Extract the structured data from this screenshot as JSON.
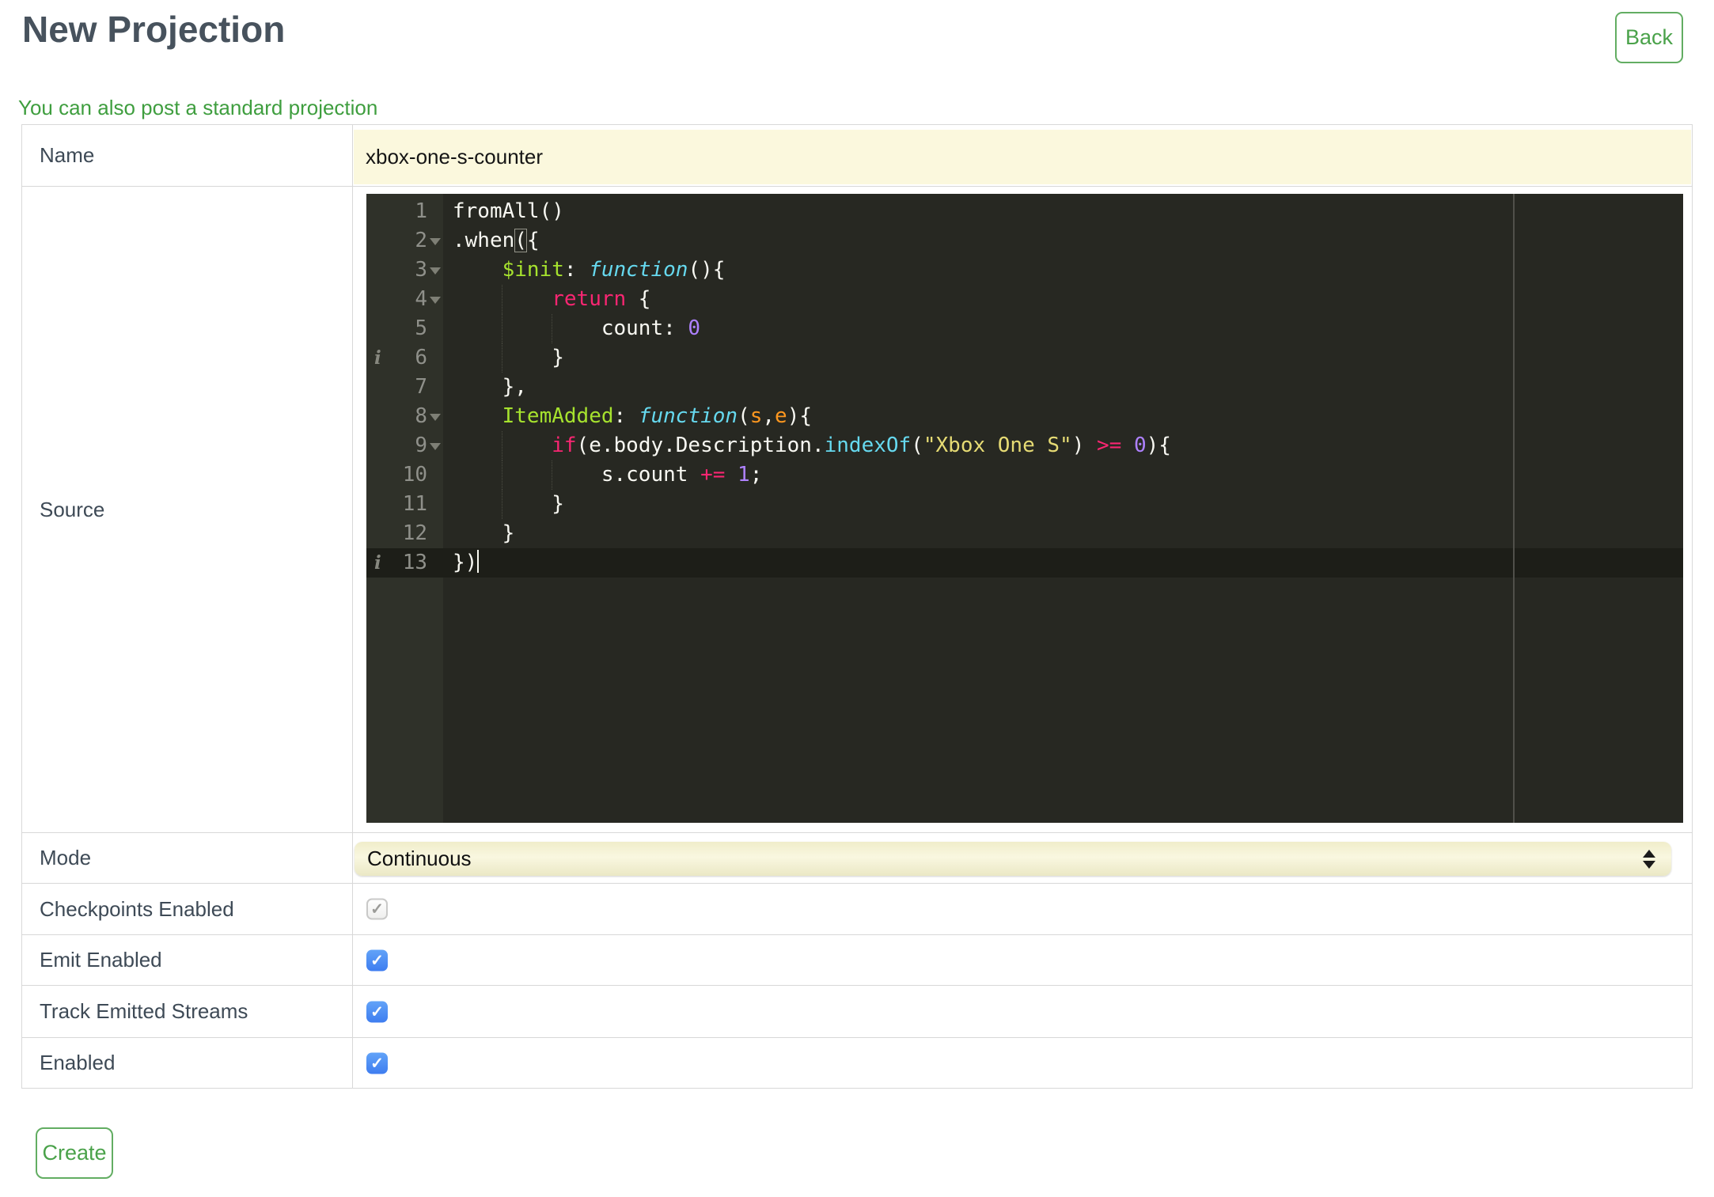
{
  "colors": {
    "accent_green": "#4aa24a",
    "link_green": "#3f9e3f",
    "checkbox_blue": "#4285f4",
    "field_yellow": "#fbf8dd",
    "select_yellow": "#f5f2d6",
    "editor_background": "#272822",
    "editor_gutter": "#2f3129",
    "label_text": "#3e4a56"
  },
  "icons": {
    "check": "✓",
    "info": "i"
  },
  "header": {
    "title": "New Projection",
    "back_label": "Back"
  },
  "standard_projection_link": "You can also post a standard projection",
  "form": {
    "name": {
      "label": "Name",
      "value": "xbox-one-s-counter"
    },
    "source": {
      "label": "Source"
    },
    "mode": {
      "label": "Mode",
      "value": "Continuous"
    },
    "checkpoints": {
      "label": "Checkpoints Enabled",
      "checked": true,
      "disabled": true
    },
    "emit": {
      "label": "Emit Enabled",
      "checked": true,
      "disabled": false
    },
    "track": {
      "label": "Track Emitted Streams",
      "checked": true,
      "disabled": false
    },
    "enabled": {
      "label": "Enabled",
      "checked": true,
      "disabled": false
    },
    "create_label": "Create"
  },
  "source_editor": {
    "value": "fromAll()\n.when({\n    $init: function(){\n        return {\n            count: 0\n        }\n    },\n    ItemAdded: function(s,e){\n        if(e.body.Description.indexOf(\"Xbox One S\") >= 0){\n            s.count += 1;\n        }\n    }\n})",
    "active_line": 13,
    "lines": [
      {
        "number": 1,
        "tokens": [
          [
            "fromAll()",
            "text"
          ]
        ]
      },
      {
        "number": 2,
        "fold": true,
        "tokens": [
          [
            ".when",
            "text"
          ],
          [
            "(",
            "text bracket"
          ],
          [
            "{",
            "text"
          ]
        ]
      },
      {
        "number": 3,
        "fold": true,
        "tokens": [
          [
            "    ",
            "text"
          ],
          [
            "$init",
            "entity"
          ],
          [
            ": ",
            "text"
          ],
          [
            "function",
            "fn"
          ],
          [
            "(){",
            "text"
          ]
        ]
      },
      {
        "number": 4,
        "fold": true,
        "guides": [
          4
        ],
        "tokens": [
          [
            "        ",
            "text"
          ],
          [
            "return",
            "kw"
          ],
          [
            " {",
            "text"
          ]
        ]
      },
      {
        "number": 5,
        "guides": [
          4,
          8
        ],
        "tokens": [
          [
            "            count: ",
            "text"
          ],
          [
            "0",
            "num"
          ]
        ]
      },
      {
        "number": 6,
        "info": true,
        "guides": [
          4
        ],
        "tokens": [
          [
            "        }",
            "text"
          ]
        ]
      },
      {
        "number": 7,
        "tokens": [
          [
            "    },",
            "text"
          ]
        ]
      },
      {
        "number": 8,
        "fold": true,
        "tokens": [
          [
            "    ",
            "text"
          ],
          [
            "ItemAdded",
            "entity"
          ],
          [
            ": ",
            "text"
          ],
          [
            "function",
            "fn"
          ],
          [
            "(",
            "text"
          ],
          [
            "s",
            "param"
          ],
          [
            ",",
            "text"
          ],
          [
            "e",
            "param"
          ],
          [
            "){",
            "text"
          ]
        ]
      },
      {
        "number": 9,
        "fold": true,
        "guides": [
          4
        ],
        "tokens": [
          [
            "        ",
            "text"
          ],
          [
            "if",
            "kw"
          ],
          [
            "(e.body.Description.",
            "text"
          ],
          [
            "indexOf",
            "support"
          ],
          [
            "(",
            "text"
          ],
          [
            "\"Xbox One S\"",
            "str"
          ],
          [
            ") ",
            "text"
          ],
          [
            ">=",
            "kw"
          ],
          [
            " ",
            "text"
          ],
          [
            "0",
            "num"
          ],
          [
            "){",
            "text"
          ]
        ]
      },
      {
        "number": 10,
        "guides": [
          4,
          8
        ],
        "tokens": [
          [
            "            s.count ",
            "text"
          ],
          [
            "+=",
            "kw"
          ],
          [
            " ",
            "text"
          ],
          [
            "1",
            "num"
          ],
          [
            ";",
            "text"
          ]
        ]
      },
      {
        "number": 11,
        "guides": [
          4
        ],
        "tokens": [
          [
            "        }",
            "text"
          ]
        ]
      },
      {
        "number": 12,
        "tokens": [
          [
            "    }",
            "text"
          ]
        ]
      },
      {
        "number": 13,
        "info": true,
        "cursor": true,
        "tokens": [
          [
            "})",
            "text"
          ]
        ]
      }
    ]
  }
}
